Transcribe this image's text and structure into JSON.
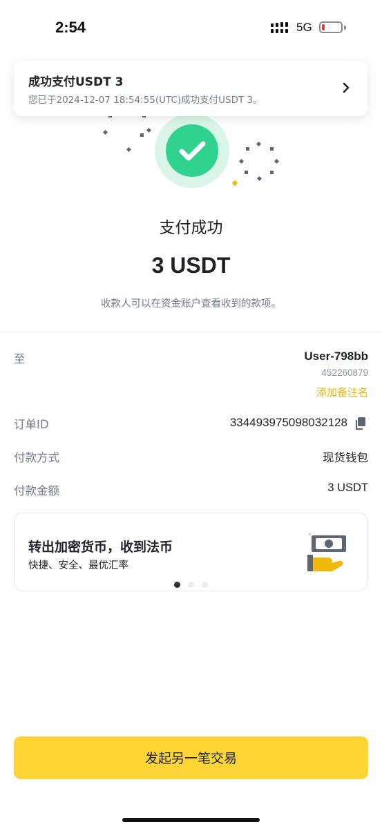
{
  "status_bar": {
    "time": "2:54",
    "network": "5G"
  },
  "notification": {
    "title": "成功支付USDT 3",
    "body": "您已于2024-12-07 18:54:55(UTC)成功支付USDT 3。",
    "chevron_icon": "chevron-right-icon"
  },
  "hero": {
    "status_title": "支付成功",
    "amount": "3 USDT",
    "note": "收款人可以在资金账户查看收到的款项。",
    "check_icon": "check-icon",
    "colors": {
      "check_bg": "#2fd38f",
      "check_halo": "#d8f5e8"
    }
  },
  "details": {
    "to_label": "至",
    "recipient_name": "User-798bb",
    "recipient_id": "452260879",
    "add_note": "添加备注名",
    "order_label": "订单ID",
    "order_id": "334493975098032128",
    "method_label": "付款方式",
    "method_value": "现货钱包",
    "amount_label": "付款金额",
    "amount_value": "3 USDT"
  },
  "promo": {
    "title": "转出加密货币，收到法币",
    "subtitle": "快捷、安全、最优汇率",
    "page_count": 3,
    "active_page": 1
  },
  "actions": {
    "primary_label": "发起另一笔交易"
  },
  "colors": {
    "accent": "#fcd535",
    "link": "#e8b400",
    "muted": "#707a8a",
    "text": "#1e2329"
  }
}
